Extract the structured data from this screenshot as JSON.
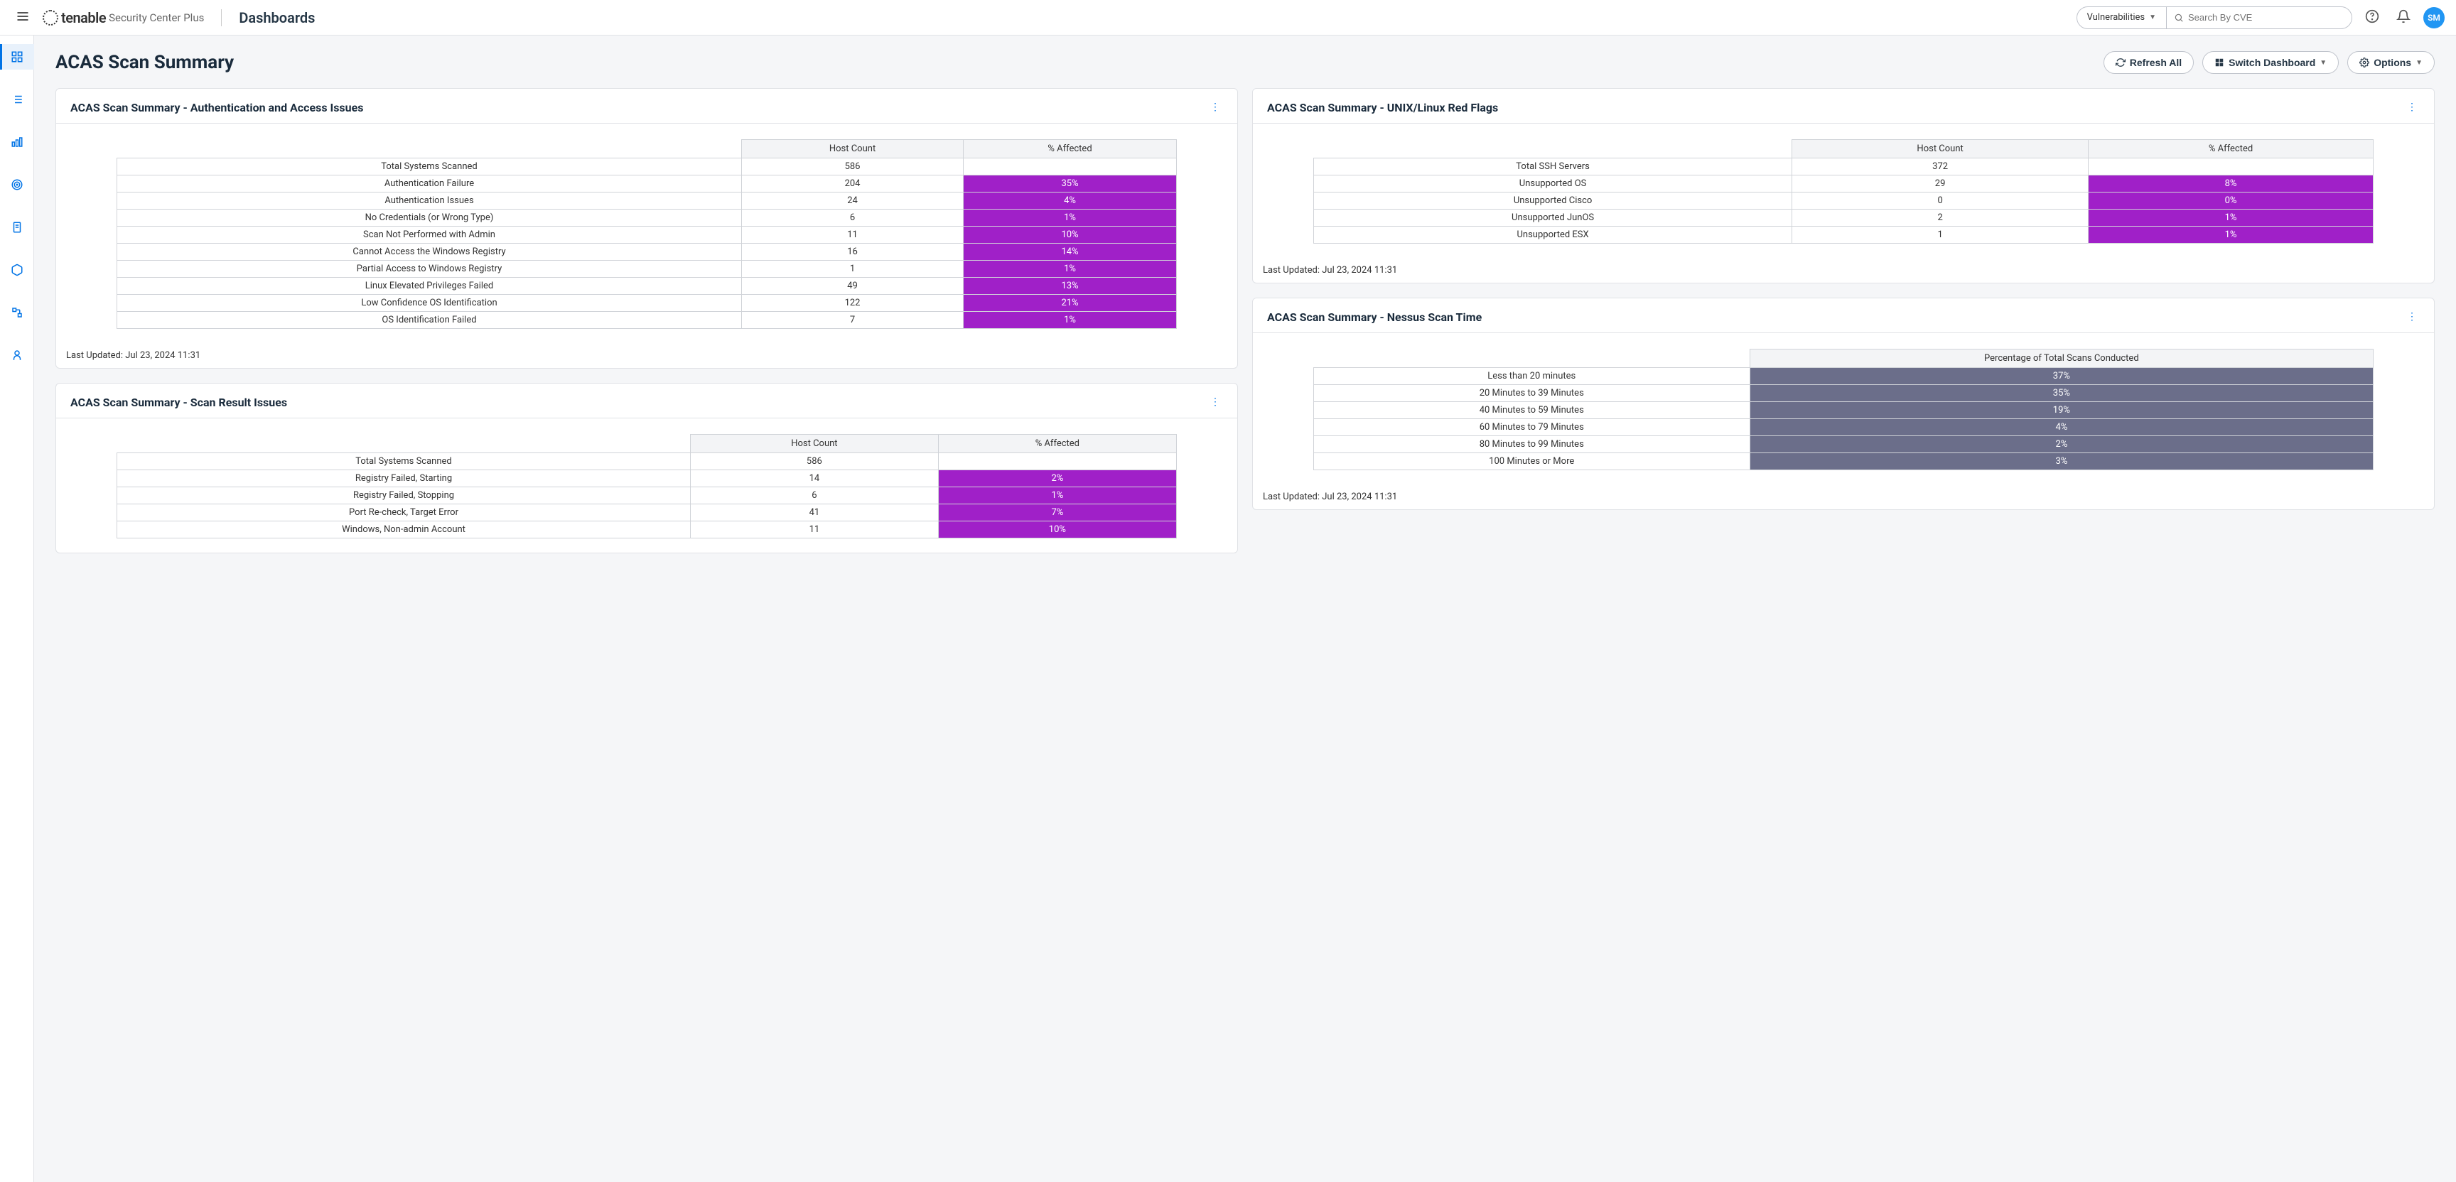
{
  "header": {
    "brand_name": "tenable",
    "brand_suffix": "Security Center Plus",
    "section": "Dashboards",
    "search_dropdown": "Vulnerabilities",
    "search_placeholder": "Search By CVE",
    "avatar_initials": "SM"
  },
  "page": {
    "title": "ACAS Scan Summary",
    "refresh_label": "Refresh All",
    "switch_label": "Switch Dashboard",
    "options_label": "Options"
  },
  "panels": {
    "auth": {
      "title": "ACAS Scan Summary - Authentication and Access Issues",
      "col1": "Host Count",
      "col2": "% Affected",
      "rows": [
        {
          "label": "Total Systems Scanned",
          "count": "586",
          "pct": ""
        },
        {
          "label": "Authentication Failure",
          "count": "204",
          "pct": "35%"
        },
        {
          "label": "Authentication Issues",
          "count": "24",
          "pct": "4%"
        },
        {
          "label": "No Credentials (or Wrong Type)",
          "count": "6",
          "pct": "1%"
        },
        {
          "label": "Scan Not Performed with Admin",
          "count": "11",
          "pct": "10%"
        },
        {
          "label": "Cannot Access the Windows Registry",
          "count": "16",
          "pct": "14%"
        },
        {
          "label": "Partial Access to Windows Registry",
          "count": "1",
          "pct": "1%"
        },
        {
          "label": "Linux Elevated Privileges Failed",
          "count": "49",
          "pct": "13%"
        },
        {
          "label": "Low Confidence OS Identification",
          "count": "122",
          "pct": "21%"
        },
        {
          "label": "OS Identification Failed",
          "count": "7",
          "pct": "1%"
        }
      ],
      "footer": "Last Updated: Jul 23, 2024 11:31"
    },
    "unix": {
      "title": "ACAS Scan Summary - UNIX/Linux Red Flags",
      "col1": "Host Count",
      "col2": "% Affected",
      "rows": [
        {
          "label": "Total SSH Servers",
          "count": "372",
          "pct": ""
        },
        {
          "label": "Unsupported OS",
          "count": "29",
          "pct": "8%"
        },
        {
          "label": "Unsupported Cisco",
          "count": "0",
          "pct": "0%"
        },
        {
          "label": "Unsupported JunOS",
          "count": "2",
          "pct": "1%"
        },
        {
          "label": "Unsupported ESX",
          "count": "1",
          "pct": "1%"
        }
      ],
      "footer": "Last Updated: Jul 23, 2024 11:31"
    },
    "scan_results": {
      "title": "ACAS Scan Summary - Scan Result Issues",
      "col1": "Host Count",
      "col2": "% Affected",
      "rows": [
        {
          "label": "Total Systems Scanned",
          "count": "586",
          "pct": ""
        },
        {
          "label": "Registry Failed, Starting",
          "count": "14",
          "pct": "2%"
        },
        {
          "label": "Registry Failed, Stopping",
          "count": "6",
          "pct": "1%"
        },
        {
          "label": "Port Re-check, Target Error",
          "count": "41",
          "pct": "7%"
        },
        {
          "label": "Windows, Non-admin Account",
          "count": "11",
          "pct": "10%"
        }
      ]
    },
    "scan_time": {
      "title": "ACAS Scan Summary - Nessus Scan Time",
      "col1": "Percentage of Total Scans Conducted",
      "rows": [
        {
          "label": "Less than 20 minutes",
          "pct": "37%"
        },
        {
          "label": "20 Minutes to 39 Minutes",
          "pct": "35%"
        },
        {
          "label": "40 Minutes to 59 Minutes",
          "pct": "19%"
        },
        {
          "label": "60 Minutes to 79 Minutes",
          "pct": "4%"
        },
        {
          "label": "80 Minutes to 99 Minutes",
          "pct": "2%"
        },
        {
          "label": "100 Minutes or More",
          "pct": "3%"
        }
      ],
      "footer": "Last Updated: Jul 23, 2024 11:31"
    }
  },
  "chart_data": [
    {
      "type": "table",
      "title": "Authentication and Access Issues",
      "categories": [
        "Total Systems Scanned",
        "Authentication Failure",
        "Authentication Issues",
        "No Credentials (or Wrong Type)",
        "Scan Not Performed with Admin",
        "Cannot Access the Windows Registry",
        "Partial Access to Windows Registry",
        "Linux Elevated Privileges Failed",
        "Low Confidence OS Identification",
        "OS Identification Failed"
      ],
      "series": [
        {
          "name": "Host Count",
          "values": [
            586,
            204,
            24,
            6,
            11,
            16,
            1,
            49,
            122,
            7
          ]
        },
        {
          "name": "% Affected",
          "values": [
            null,
            35,
            4,
            1,
            10,
            14,
            1,
            13,
            21,
            1
          ]
        }
      ]
    },
    {
      "type": "table",
      "title": "UNIX/Linux Red Flags",
      "categories": [
        "Total SSH Servers",
        "Unsupported OS",
        "Unsupported Cisco",
        "Unsupported JunOS",
        "Unsupported ESX"
      ],
      "series": [
        {
          "name": "Host Count",
          "values": [
            372,
            29,
            0,
            2,
            1
          ]
        },
        {
          "name": "% Affected",
          "values": [
            null,
            8,
            0,
            1,
            1
          ]
        }
      ]
    },
    {
      "type": "table",
      "title": "Scan Result Issues",
      "categories": [
        "Total Systems Scanned",
        "Registry Failed, Starting",
        "Registry Failed, Stopping",
        "Port Re-check, Target Error",
        "Windows, Non-admin Account"
      ],
      "series": [
        {
          "name": "Host Count",
          "values": [
            586,
            14,
            6,
            41,
            11
          ]
        },
        {
          "name": "% Affected",
          "values": [
            null,
            2,
            1,
            7,
            10
          ]
        }
      ]
    },
    {
      "type": "table",
      "title": "Nessus Scan Time",
      "categories": [
        "Less than 20 minutes",
        "20 Minutes to 39 Minutes",
        "40 Minutes to 59 Minutes",
        "60 Minutes to 79 Minutes",
        "80 Minutes to 99 Minutes",
        "100 Minutes or More"
      ],
      "series": [
        {
          "name": "Percentage of Total Scans Conducted",
          "values": [
            37,
            35,
            19,
            4,
            2,
            3
          ]
        }
      ]
    }
  ]
}
